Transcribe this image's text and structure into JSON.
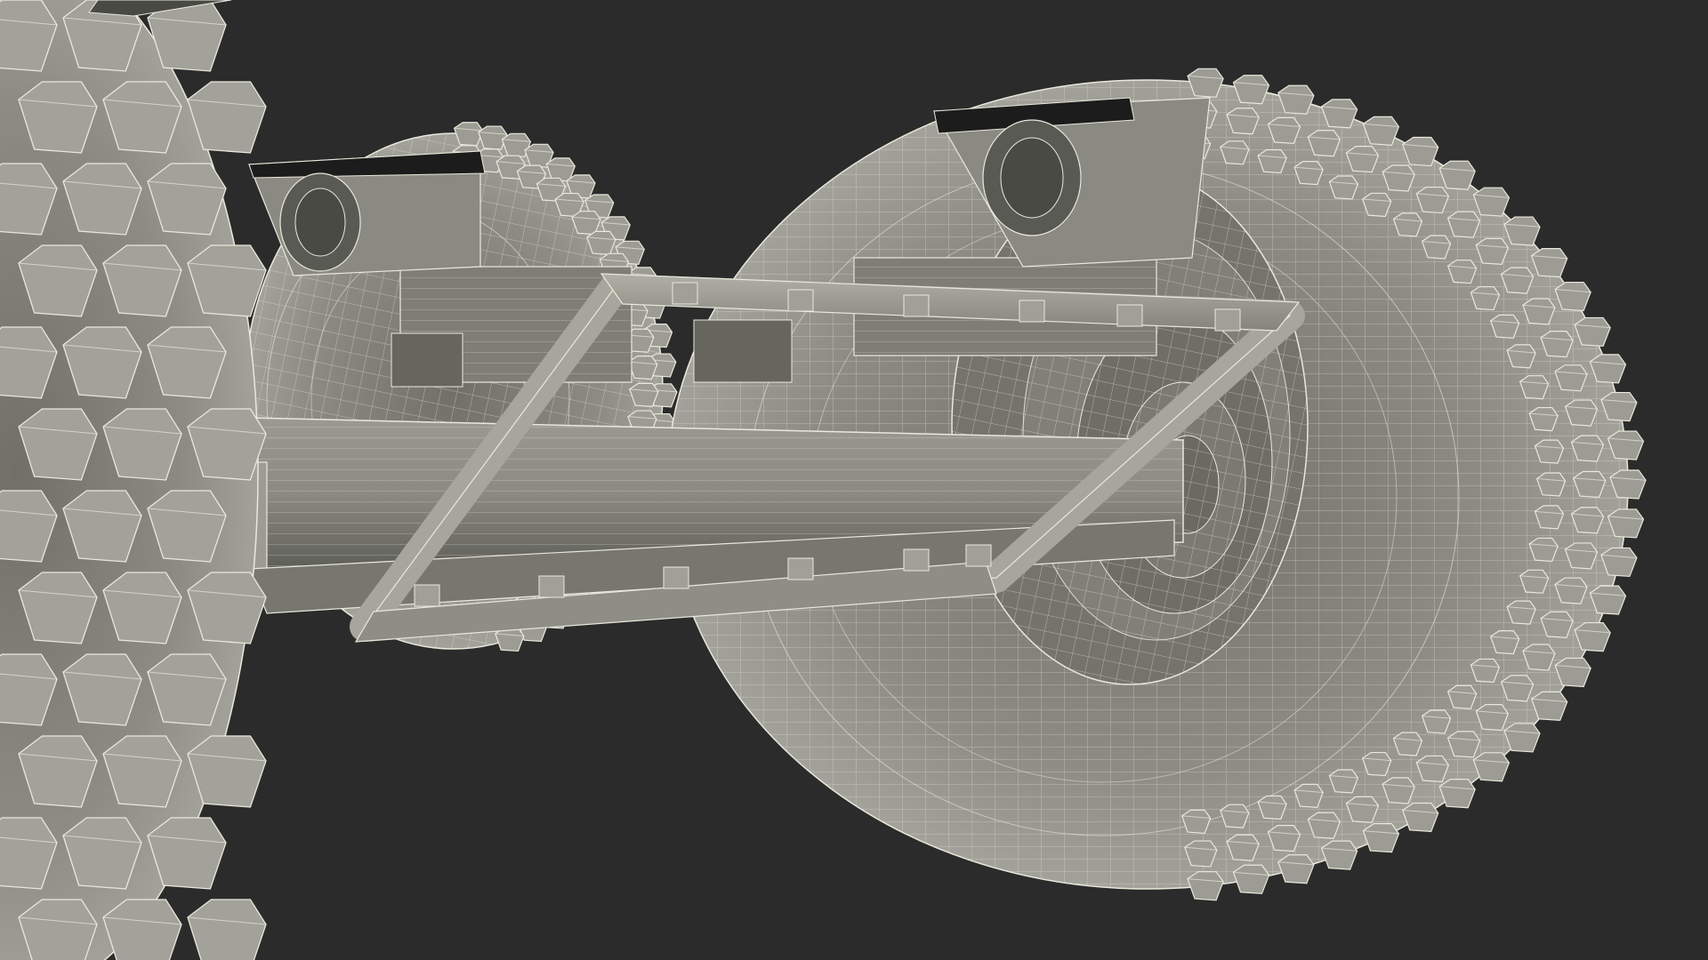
{
  "scene": {
    "background_color": "#2b2b2b",
    "model_color": "#8c8c84",
    "wire_color": "#e8e8dc",
    "shadow_color": "#5a5a55",
    "highlight_color": "#b4b4aa"
  }
}
